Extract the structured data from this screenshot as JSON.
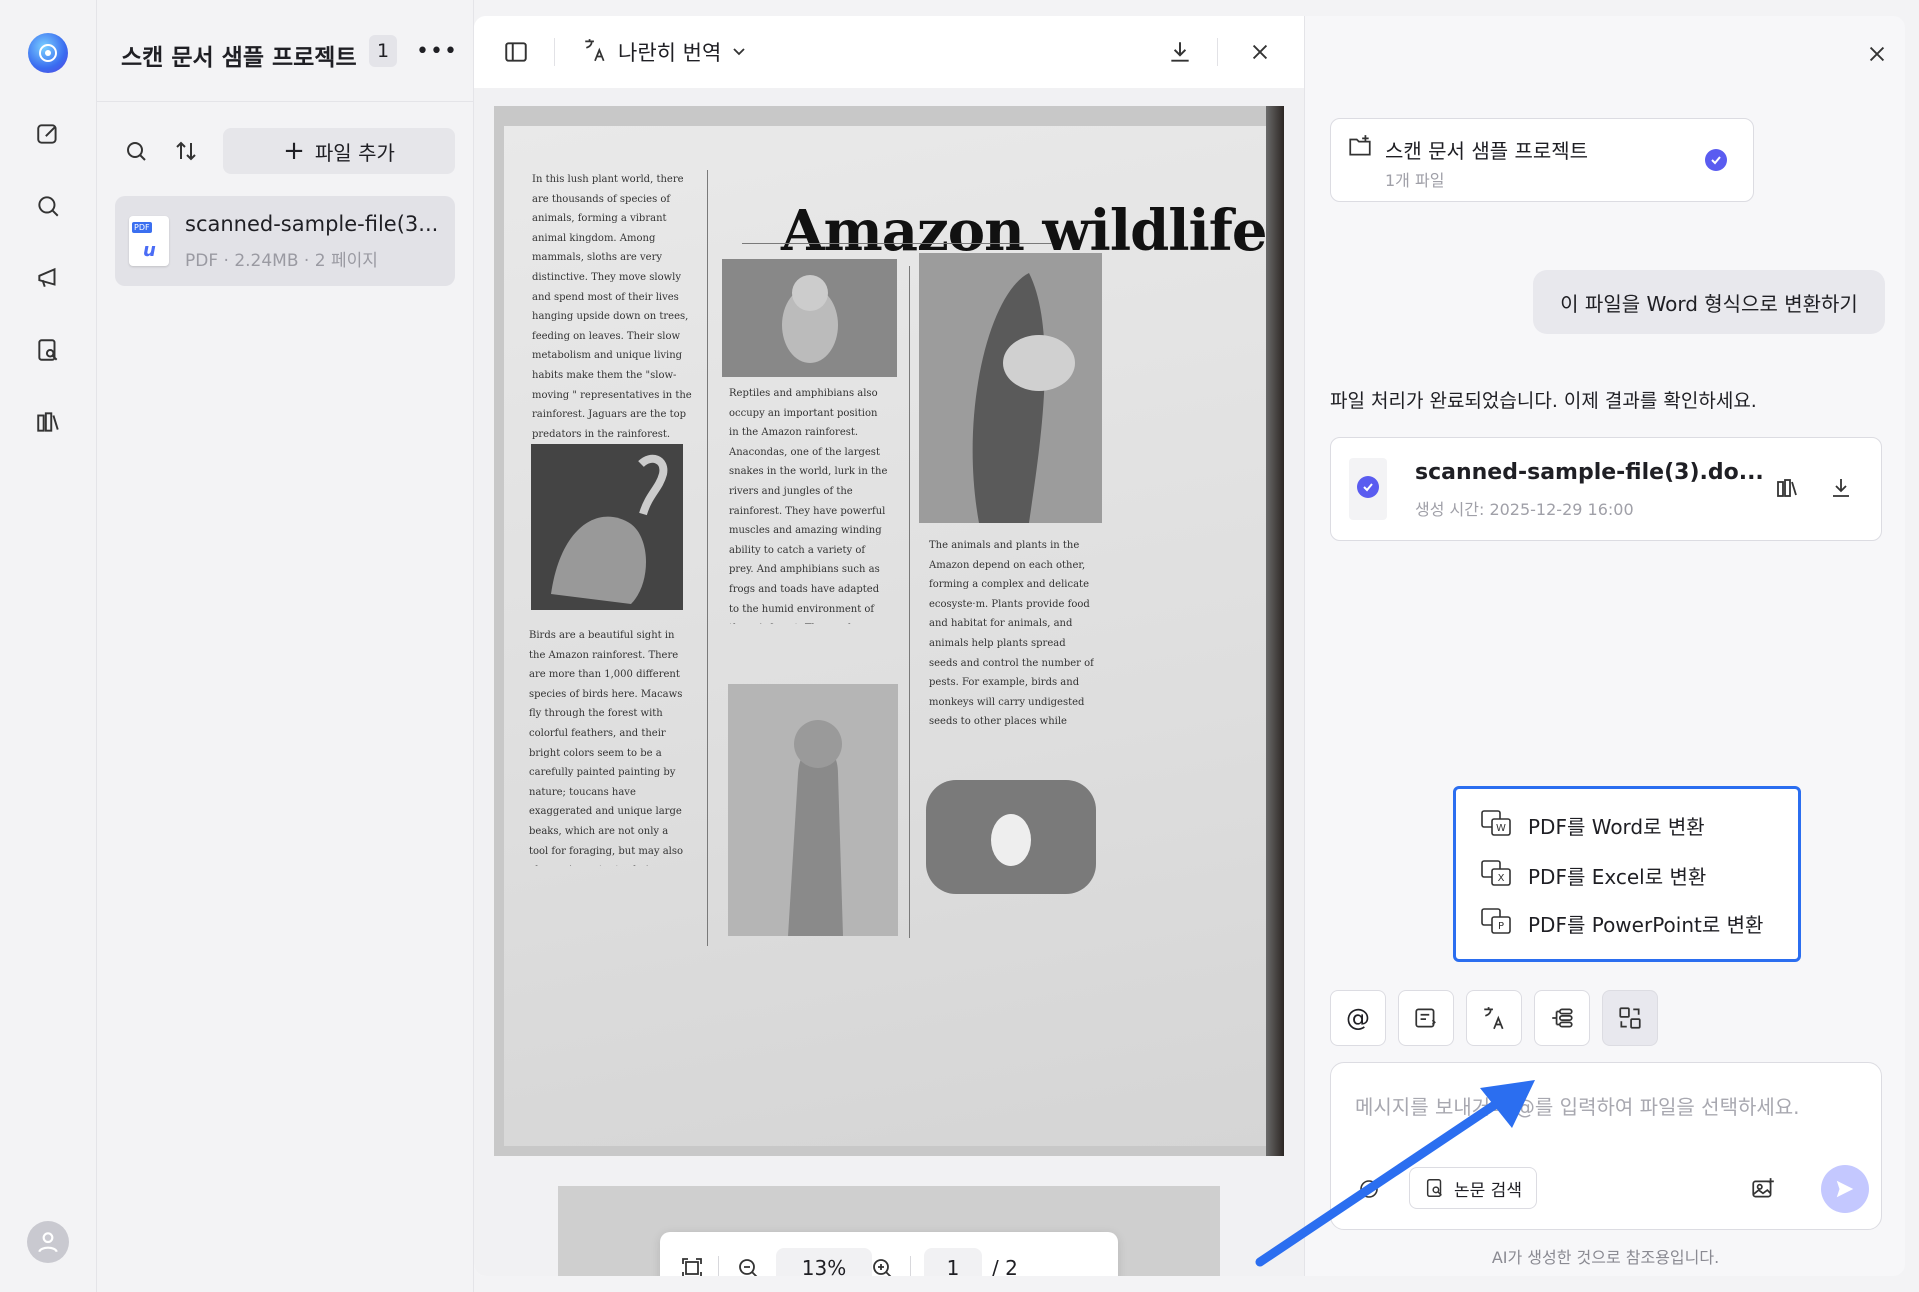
{
  "rail": {
    "icons": [
      "app-logo",
      "edit-icon",
      "search-icon",
      "megaphone-icon",
      "doc-search-icon",
      "library-icon",
      "user-icon"
    ]
  },
  "file_panel": {
    "project_title": "스캔 문서 샘플 프로젝트",
    "file_count": "1",
    "add_file_label": "파일 추가",
    "file": {
      "name": "scanned-sample-file(3...",
      "meta": "PDF · 2.24MB · 2 페이지",
      "type_tag": "PDF"
    }
  },
  "viewer": {
    "mode_label": "나란히 번역",
    "document": {
      "title": "Amazon wildlife",
      "col1_text": "In this lush plant world, there are thousands of species of animals, forming a vibrant animal kingdom. Among mammals, sloths are very distinctive. They move slowly and spend most of their lives hanging upside down on trees, feeding on leaves. Their slow metabolism and unique living habits make them the \"slow-moving \" representatives in the rainforest. Jaguars are the top predators in the rainforest. They are covered with dark ring-shaped markings and appear and disappear like ghosts in the jungle. As good swimmers, jaguars can not only chase prey such as deer and monkeys on land, but also catch fish, turtles and small crocodiles in the water.",
      "col1b_text": "Birds are a beautiful sight in the Amazon rainforest. There are more than 1,000 different species of birds here. Macaws fly through the forest with colorful feathers, and their bright colors seem to be a carefully painted painting by nature; toucans have exaggerated and unique large beaks, which are not only a tool for foraging, but may also play an important role in behaviors such as courtship; hummingbirds are known for their light posture and fast-beating wings. They can hover in the air to suck nectar, showing extraordinary flying skills.",
      "col2_text": "Reptiles and amphibians also occupy an important position in the Amazon rainforest. Anacondas, one of the largest snakes in the world, lurk in the rivers and jungles of the rainforest. They have powerful muscles and amazing winding ability to catch a variety of prey. And amphibians such as frogs and toads have adapted to the humid environment of the rainforest. They make unique calls during the breeding season, forming a lively \"rainforest chorus\". However, due to habitat destruction and environmental changes, many amphibian populations are facing serious threats.",
      "col3_text": "The animals and plants in the Amazon depend on each other, forming a complex and delicate ecosyste·m. Plants provide food and habitat for animals, and animals help plants spread seeds and control the number of pests. For example, birds and monkeys will carry undigested seeds to other places while eating fruits, promoting the reproduction of plants; while some insects feed on the nectar of plants and help plants complete pollination in the process of collecting nectar."
    },
    "zoom": "13%",
    "page_current": "1",
    "page_total": "/ 2"
  },
  "chat": {
    "project": {
      "name": "스캔 문서 샘플 프로젝트",
      "subtitle": "1개 파일"
    },
    "user_message": "이 파일을 Word 형식으로 변환하기",
    "ai_message": "파일 처리가 완료되었습니다. 이제 결과를 확인하세요.",
    "result": {
      "name": "scanned-sample-file(3).do...",
      "time": "생성 시간: 2025-12-29 16:00"
    },
    "convert_menu": [
      {
        "label": "PDF를 Word로 변환",
        "icon": "W"
      },
      {
        "label": "PDF를 Excel로 변환",
        "icon": "X"
      },
      {
        "label": "PDF를 PowerPoint로 변환",
        "icon": "P"
      }
    ],
    "tools": [
      "at-icon",
      "summary-icon",
      "translate-icon",
      "mindmap-icon",
      "convert-icon"
    ],
    "input_placeholder": "메시지를 보내거나 @를 입력하여 파일을 선택하세요.",
    "paper_search_label": "논문 검색",
    "disclaimer": "AI가 생성한 것으로 참조용입니다.",
    "accent_color": "#5a5cf0",
    "highlight_color": "#2b6ef0"
  }
}
